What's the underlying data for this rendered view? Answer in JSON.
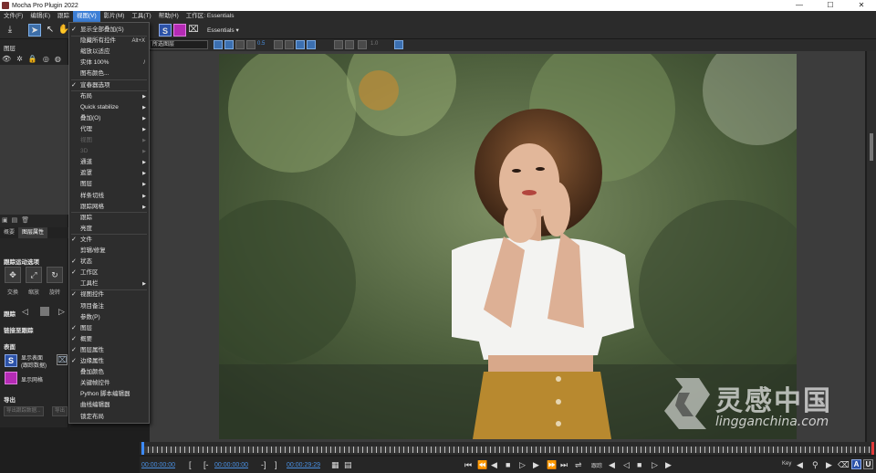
{
  "window": {
    "title": "Mocha Pro Plugin 2022",
    "minimize": "—",
    "maximize": "☐",
    "close": "✕"
  },
  "menubar": {
    "items": [
      "文件(F)",
      "编辑(E)",
      "跟踪",
      "视图(V)",
      "影片(M)",
      "工具(T)",
      "帮助(H)",
      "工作区: Essentials"
    ],
    "active_index": 3
  },
  "toolbar": {
    "workspace_label": "Essentials",
    "workspace_arrow": "▾"
  },
  "toolbar2": {
    "layer_dropdown": "所选图层",
    "zoom_value": "0.5",
    "value_field": "1.0"
  },
  "left_panel": {
    "layers_title": "图层",
    "tabs": [
      "概要",
      "图层属性"
    ],
    "active_tab": 1,
    "track_motion_title": "跟踪运动选项",
    "track_buttons": [
      "交换",
      "缩放",
      "旋转"
    ],
    "track_title": "跟踪",
    "link_title": "链接至跟踪",
    "surface_title": "表面",
    "surface_label_1": "显示表面",
    "surface_label_1b": "(跟踪数据)",
    "surface_label_2": "显示网格",
    "export_title": "导出",
    "export_btn_1": "导出跟踪数据...",
    "export_btn_2": "导出"
  },
  "dropdown": {
    "items": [
      {
        "label": "显示全部叠加(S)",
        "checked": true,
        "arrow": false,
        "shortcut": "",
        "disabled": false
      },
      {
        "label": "隐藏所有控件",
        "checked": false,
        "arrow": false,
        "shortcut": "Alt+X",
        "disabled": false
      },
      {
        "label": "缩放以适应",
        "checked": false,
        "arrow": false,
        "shortcut": "",
        "disabled": false
      },
      {
        "label": "实体 100%",
        "checked": false,
        "arrow": false,
        "shortcut": "/",
        "disabled": false
      },
      {
        "label": "图布颜色...",
        "checked": false,
        "arrow": false,
        "shortcut": "",
        "disabled": false
      },
      {
        "label": "宣春器选项",
        "checked": true,
        "arrow": false,
        "shortcut": "",
        "disabled": false
      },
      {
        "label": "布局",
        "checked": false,
        "arrow": true,
        "shortcut": "",
        "disabled": false
      },
      {
        "label": "Quick stabilize",
        "checked": false,
        "arrow": true,
        "shortcut": "",
        "disabled": false
      },
      {
        "label": "叠加(O)",
        "checked": false,
        "arrow": true,
        "shortcut": "",
        "disabled": false
      },
      {
        "label": "代理",
        "checked": false,
        "arrow": true,
        "shortcut": "",
        "disabled": false
      },
      {
        "label": "视图",
        "checked": false,
        "arrow": true,
        "shortcut": "",
        "disabled": true
      },
      {
        "label": "3D",
        "checked": false,
        "arrow": true,
        "shortcut": "",
        "disabled": true
      },
      {
        "label": "通道",
        "checked": false,
        "arrow": true,
        "shortcut": "",
        "disabled": false
      },
      {
        "label": "遮罩",
        "checked": false,
        "arrow": true,
        "shortcut": "",
        "disabled": false
      },
      {
        "label": "图层",
        "checked": false,
        "arrow": true,
        "shortcut": "",
        "disabled": false
      },
      {
        "label": "样条切线",
        "checked": false,
        "arrow": true,
        "shortcut": "",
        "disabled": false
      },
      {
        "label": "跟踪网格",
        "checked": false,
        "arrow": true,
        "shortcut": "",
        "disabled": false
      },
      {
        "label": "跟踪",
        "checked": false,
        "arrow": false,
        "shortcut": "",
        "disabled": false
      },
      {
        "label": "亮度",
        "checked": false,
        "arrow": false,
        "shortcut": "",
        "disabled": false
      },
      {
        "label": "文件",
        "checked": true,
        "arrow": false,
        "shortcut": "",
        "disabled": false
      },
      {
        "label": "剪辑/修复",
        "checked": false,
        "arrow": false,
        "shortcut": "",
        "disabled": false
      },
      {
        "label": "状态",
        "checked": true,
        "arrow": false,
        "shortcut": "",
        "disabled": false
      },
      {
        "label": "工作区",
        "checked": true,
        "arrow": false,
        "shortcut": "",
        "disabled": false
      },
      {
        "label": "工具栏",
        "checked": false,
        "arrow": true,
        "shortcut": "",
        "disabled": false
      },
      {
        "label": "视图控件",
        "checked": true,
        "arrow": false,
        "shortcut": "",
        "disabled": false
      },
      {
        "label": "项目备注",
        "checked": false,
        "arrow": false,
        "shortcut": "",
        "disabled": false
      },
      {
        "label": "参数(P)",
        "checked": false,
        "arrow": false,
        "shortcut": "",
        "disabled": false
      },
      {
        "label": "图层",
        "checked": true,
        "arrow": false,
        "shortcut": "",
        "disabled": false
      },
      {
        "label": "概要",
        "checked": true,
        "arrow": false,
        "shortcut": "",
        "disabled": false
      },
      {
        "label": "图层属性",
        "checked": true,
        "arrow": false,
        "shortcut": "",
        "disabled": false
      },
      {
        "label": "边缘属性",
        "checked": true,
        "arrow": false,
        "shortcut": "",
        "disabled": false
      },
      {
        "label": "叠加颜色",
        "checked": false,
        "arrow": false,
        "shortcut": "",
        "disabled": false
      },
      {
        "label": "关键帧控件",
        "checked": false,
        "arrow": false,
        "shortcut": "",
        "disabled": false
      },
      {
        "label": "Python 脚本编辑器",
        "checked": false,
        "arrow": false,
        "shortcut": "",
        "disabled": false
      },
      {
        "label": "曲线编辑器",
        "checked": false,
        "arrow": false,
        "shortcut": "",
        "disabled": false
      },
      {
        "label": "锁定布局",
        "checked": false,
        "arrow": false,
        "shortcut": "",
        "disabled": false
      }
    ]
  },
  "watermark": {
    "big": "灵感中国",
    "small": "lingganchina.com"
  },
  "transport": {
    "in_time": "00:00:00:00",
    "current_time": "00:00:00:00",
    "out_time": "00:00:29:29",
    "track_label": "跟踪",
    "key_label": "Key",
    "badge_a": "A",
    "badge_u": "U"
  },
  "colors": {
    "accent": "#3d7fd6",
    "timecode": "#4a8fe0",
    "playhead": "#3d8bfd",
    "outpoint": "#e03a3a"
  }
}
